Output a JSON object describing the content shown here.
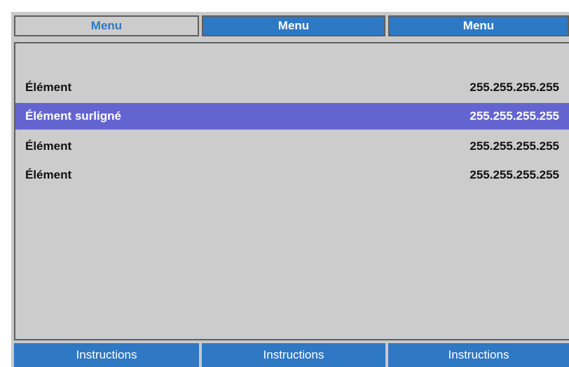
{
  "tabs": [
    {
      "label": "Menu",
      "state": "active"
    },
    {
      "label": "Menu",
      "state": "inactive"
    },
    {
      "label": "Menu",
      "state": "inactive"
    }
  ],
  "items": [
    {
      "label": "Élément",
      "value": "255.255.255.255",
      "highlighted": false
    },
    {
      "label": "Élément surligné",
      "value": "255.255.255.255",
      "highlighted": true
    },
    {
      "label": "Élément",
      "value": "255.255.255.255",
      "highlighted": false
    },
    {
      "label": "Élément",
      "value": "255.255.255.255",
      "highlighted": false
    }
  ],
  "footer": [
    {
      "label": "Instructions"
    },
    {
      "label": "Instructions"
    },
    {
      "label": "Instructions"
    }
  ],
  "colors": {
    "accent": "#2e78c4",
    "highlight": "#6464d0",
    "background": "#cccccc",
    "border": "#5f5f5f"
  }
}
